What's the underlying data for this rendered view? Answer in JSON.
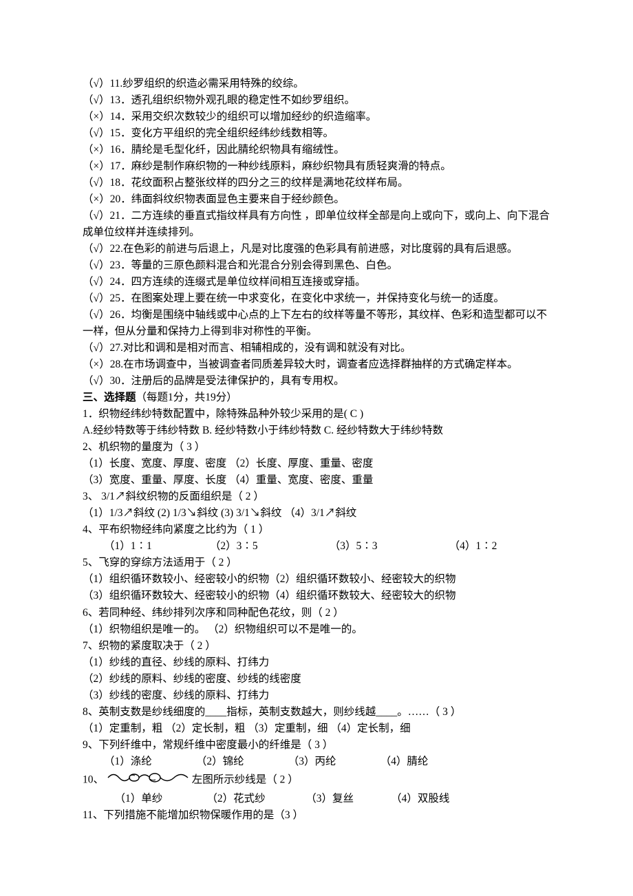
{
  "tf": {
    "l11": "（√）11.纱罗组织的织造必需采用特殊的绞综。",
    "l13": "（√）13．透孔组织织物外观孔眼的稳定性不如纱罗组织。",
    "l14": "（×）14．采用交织次数较少的组织可以增加经纱的织造缩率。",
    "l15": "（√）15．变化方平组织的完全组织经纬纱线数相等。",
    "l16": "（×）16．腈纶是毛型化纤，因此腈纶织物具有缩绒性。",
    "l17": "（×）17．麻纱是制作麻织物的一种纱线原料，麻纱织物具有质轻爽滑的特点。",
    "l18": "（√）18．花纹面积占整张纹样的四分之三的纹样是满地花纹样布局。",
    "l20": "（×）20．纬面斜纹织物表面显色主要来自于经纱颜色。",
    "l21": "（√）21．二方连续的垂直式指纹样具有方向性 ，即单位纹样全部是向上或向下，或向上、向下混合成单位纹样并连续排列。",
    "l22": "（√）22.在色彩的前进与后退上，凡是对比度强的色彩具有前进感，对比度弱的具有后退感。",
    "l23": "（√）23．等量的三原色颜料混合和光混合分别会得到黑色、白色。",
    "l24": "（√）24．四方连续的连缀式是单位纹样间相互连接或穿插。",
    "l25": "（√）25．在图案处理上要在统一中求变化，在变化中求统一，并保持变化与统一的适度。",
    "l26": "（√）26．均衡是围绕中轴线或中心点的上下左右的纹样等量不等形，其纹样、色彩和造型都可以不一样，但从分量和保持力上得到非对称性的平衡。",
    "l27": "（√）27.对比和调和是相对而言、相辅相成的，没有调和就没有对比。",
    "l28": "（×）28.在市场调查中，当被调查者同质差异较大时，调查者应选择群抽样的方式确定样本。",
    "l30": "（√）30．注册后的品牌是受法律保护的，具有专用权。"
  },
  "section3": {
    "title": "三、选择题",
    "note": "（每题1分，共19分）"
  },
  "mc": {
    "q1": {
      "stem": "1．织物经纬纱特数配置中，除特殊品种外较少采用的是(   C   )",
      "opts": " A.经纱特数等于纬纱特数   B. 经纱特数小于纬纱特数  C. 经纱特数大于纬纱特数"
    },
    "q2": {
      "stem": "2、机织物的量度为（ 3 ）",
      "opt1": "（1）长度、宽度、厚度、密度   （2）长度、厚度、重量、密度",
      "opt2": "（3）宽度、重量、厚度、长度   （4）重量、宽度、密度、重量"
    },
    "q3": {
      "stem": "3、 3/1↗斜纹织物的反面组织是（ 2 ）",
      "opts": "（1）1/3↗斜纹    (2) 1/3↘斜纹    (3) 3/1↘斜纹  （4）3/1↗斜纹"
    },
    "q4": {
      "stem": "4、平布织物经纬向紧度之比约为（ 1 ）",
      "a": "（1）1∶1",
      "b": "（2）3∶5",
      "c": "（3）5∶3",
      "d": "（4）1∶2"
    },
    "q5": {
      "stem": "5、飞穿的穿综方法适用于（ 2 ）",
      "opt1": "（1）组织循环数较小、经密较小的织物（2）组织循环数较小、经密较大的织物",
      "opt2": "（3）组织循环数较大、经密较小的织物（4）组织循环数较大、经密较大的织物"
    },
    "q6": {
      "stem": "6、若同种经、纬纱排列次序和同种配色花纹，则（ 2 ）",
      "opts": "（1）织物组织是唯一的。     （2）织物组织可以不是唯一的。"
    },
    "q7": {
      "stem": "7、织物的紧度取决于（ 2 ）",
      "o1": "（1）纱线的直径、纱线的原料、打纬力",
      "o2": "（2）纱线的原料、纱线的密度、纱线的线密度",
      "o3": "（3）纱线的密度、纱线的原料、打纬力"
    },
    "q8": {
      "stem": "8、英制支数是纱线细度的____指标，英制支数越大，则纱线越____。……（ 3 ）",
      "opts": "（1）定重制，粗   （2）定长制，粗   （3）定重制，细   （4）定长制，细"
    },
    "q9": {
      "stem": "9、下列纤维中，常规纤维中密度最小的纤维是（ 3 ）",
      "a": "（1）涤纶",
      "b": "（2）锦纶",
      "c": "（3）丙纶",
      "d": "（4）腈纶"
    },
    "q10": {
      "prefix": "10、",
      "suffix": "左图所示纱线是（ 2 ）",
      "a": "（1）单纱",
      "b": "（2）花式纱",
      "c": "（3）复丝",
      "d": "（4）双股线",
      "icon_name": "fancy-yarn-icon"
    },
    "q11": {
      "stem": "11、下列措施不能增加织物保暖作用的是（3 ）"
    }
  }
}
